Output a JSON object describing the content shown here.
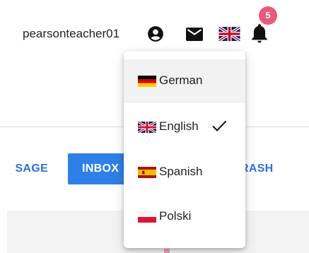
{
  "header": {
    "username": "pearsonteacher01",
    "notification_count": "5"
  },
  "tabs": {
    "message_label": "SAGE",
    "inbox_label": "INBOX",
    "trash_label": "RASH"
  },
  "language_menu": {
    "selected": "English",
    "items": [
      {
        "label": "German",
        "flag": "germany-flag-icon",
        "highlighted": true,
        "checked": false
      },
      {
        "label": "English",
        "flag": "uk-flag-icon",
        "highlighted": false,
        "checked": true
      },
      {
        "label": "Spanish",
        "flag": "spain-flag-icon",
        "highlighted": false,
        "checked": false
      },
      {
        "label": "Polski",
        "flag": "poland-flag-icon",
        "highlighted": false,
        "checked": false
      }
    ]
  },
  "icons": {
    "account": "account-circle-icon",
    "mail": "mail-icon",
    "language": "uk-flag-icon",
    "notifications": "bell-icon",
    "check": "checkmark-icon"
  },
  "colors": {
    "accent": "#2f80e6",
    "badge": "#e85a7a",
    "menu_highlight": "#f2f2f2"
  }
}
